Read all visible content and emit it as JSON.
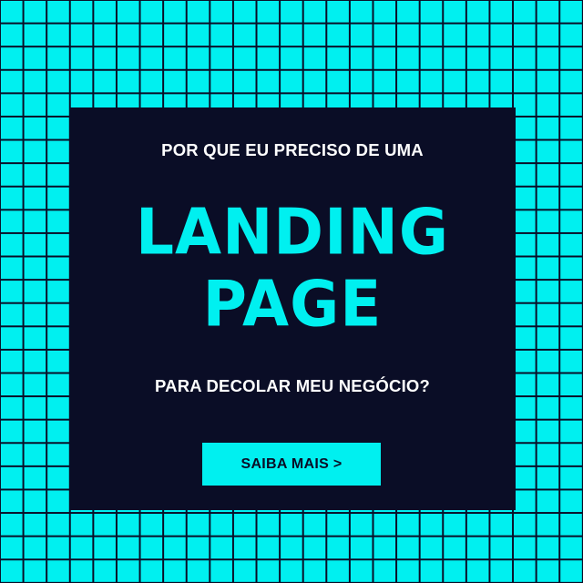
{
  "card": {
    "intro": "POR QUE EU PRECISO DE UMA",
    "headline_line1": "LANDING",
    "headline_line2": "PAGE",
    "question": "PARA DECOLAR MEU NEGÓCIO?",
    "cta_label": "SAIBA MAIS >"
  },
  "colors": {
    "accent": "#00F0F0",
    "dark": "#0a0d26",
    "text_light": "#ffffff"
  }
}
